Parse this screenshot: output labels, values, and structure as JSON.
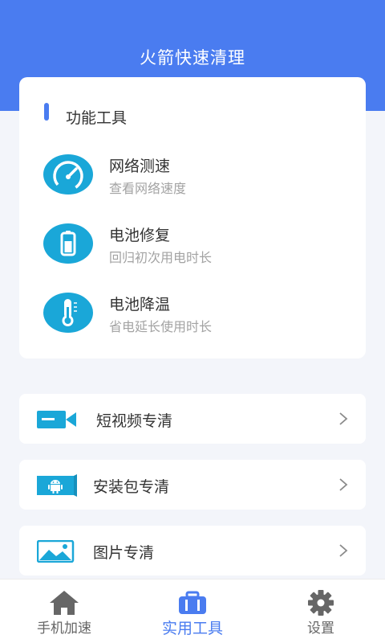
{
  "header": {
    "title": "火箭快速清理"
  },
  "tools": {
    "section_title": "功能工具",
    "items": [
      {
        "title": "网络测速",
        "subtitle": "查看网络速度",
        "icon": "speedometer-icon"
      },
      {
        "title": "电池修复",
        "subtitle": "回归初次用电时长",
        "icon": "battery-icon"
      },
      {
        "title": "电池降温",
        "subtitle": "省电延长使用时长",
        "icon": "thermometer-icon"
      }
    ]
  },
  "cleaners": [
    {
      "label": "短视频专清",
      "icon": "video-camera-icon"
    },
    {
      "label": "安装包专清",
      "icon": "android-icon"
    },
    {
      "label": "图片专清",
      "icon": "picture-icon"
    }
  ],
  "tabbar": {
    "tabs": [
      {
        "label": "手机加速",
        "icon": "home-icon",
        "active": false
      },
      {
        "label": "实用工具",
        "icon": "toolbox-icon",
        "active": true
      },
      {
        "label": "设置",
        "icon": "gear-icon",
        "active": false
      }
    ]
  },
  "colors": {
    "accent": "#4a7cf0",
    "icon_teal": "#1aa7d8",
    "background": "#f3f5fa",
    "inactive_tab": "#666666"
  }
}
